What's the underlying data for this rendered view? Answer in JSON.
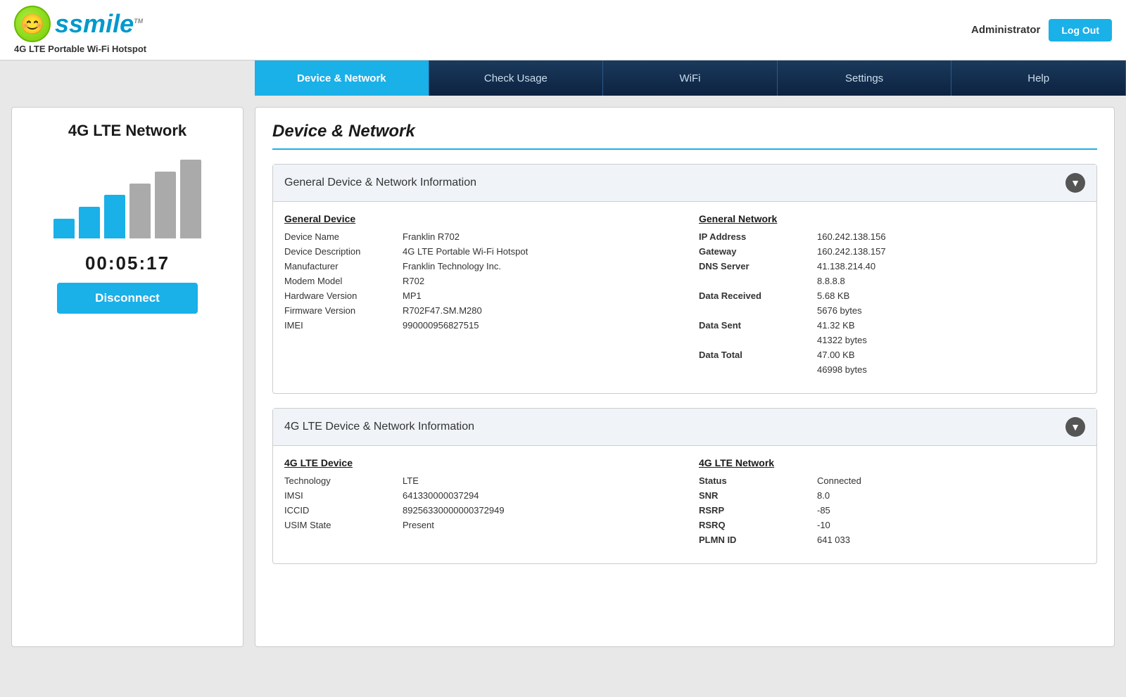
{
  "header": {
    "logo_text": "smile",
    "tagline": "4G LTE Portable Wi-Fi Hotspot",
    "admin_label": "Administrator",
    "logout_label": "Log Out"
  },
  "nav": {
    "items": [
      {
        "label": "Device & Network",
        "active": true
      },
      {
        "label": "Check Usage",
        "active": false
      },
      {
        "label": "WiFi",
        "active": false
      },
      {
        "label": "Settings",
        "active": false
      },
      {
        "label": "Help",
        "active": false
      }
    ]
  },
  "sidebar": {
    "title": "4G LTE Network",
    "timer": "00:05:17",
    "disconnect_label": "Disconnect"
  },
  "content": {
    "page_title": "Device & Network",
    "sections": [
      {
        "id": "general",
        "title": "General Device & Network Information",
        "left_col_title": "General Device",
        "left_rows": [
          {
            "label": "Device Name",
            "value": "Franklin R702"
          },
          {
            "label": "Device Description",
            "value": "4G LTE Portable Wi-Fi Hotspot"
          },
          {
            "label": "Manufacturer",
            "value": "Franklin Technology Inc."
          },
          {
            "label": "Modem Model",
            "value": "R702"
          },
          {
            "label": "Hardware Version",
            "value": "MP1"
          },
          {
            "label": "Firmware Version",
            "value": "R702F47.SM.M280"
          },
          {
            "label": "IMEI",
            "value": "990000956827515"
          }
        ],
        "right_col_title": "General Network",
        "right_rows": [
          {
            "label": "IP Address",
            "value": "160.242.138.156",
            "sub": null
          },
          {
            "label": "Gateway",
            "value": "160.242.138.157",
            "sub": null
          },
          {
            "label": "DNS Server",
            "value": "41.138.214.40",
            "sub": "8.8.8.8"
          },
          {
            "label": "Data Received",
            "value": "5.68 KB",
            "sub": "5676 bytes"
          },
          {
            "label": "Data Sent",
            "value": "41.32 KB",
            "sub": "41322 bytes"
          },
          {
            "label": "Data Total",
            "value": "47.00 KB",
            "sub": "46998 bytes"
          }
        ]
      },
      {
        "id": "lte",
        "title": "4G LTE Device & Network Information",
        "left_col_title": "4G LTE Device",
        "left_rows": [
          {
            "label": "Technology",
            "value": "LTE"
          },
          {
            "label": "IMSI",
            "value": "641330000037294"
          },
          {
            "label": "ICCID",
            "value": "89256330000000372949"
          },
          {
            "label": "USIM State",
            "value": "Present"
          }
        ],
        "right_col_title": "4G LTE Network",
        "right_rows": [
          {
            "label": "Status",
            "value": "Connected",
            "sub": null
          },
          {
            "label": "SNR",
            "value": "8.0",
            "sub": null
          },
          {
            "label": "RSRP",
            "value": "-85",
            "sub": null
          },
          {
            "label": "RSRQ",
            "value": "-10",
            "sub": null
          },
          {
            "label": "PLMN ID",
            "value": "641 033",
            "sub": null
          }
        ]
      }
    ]
  }
}
